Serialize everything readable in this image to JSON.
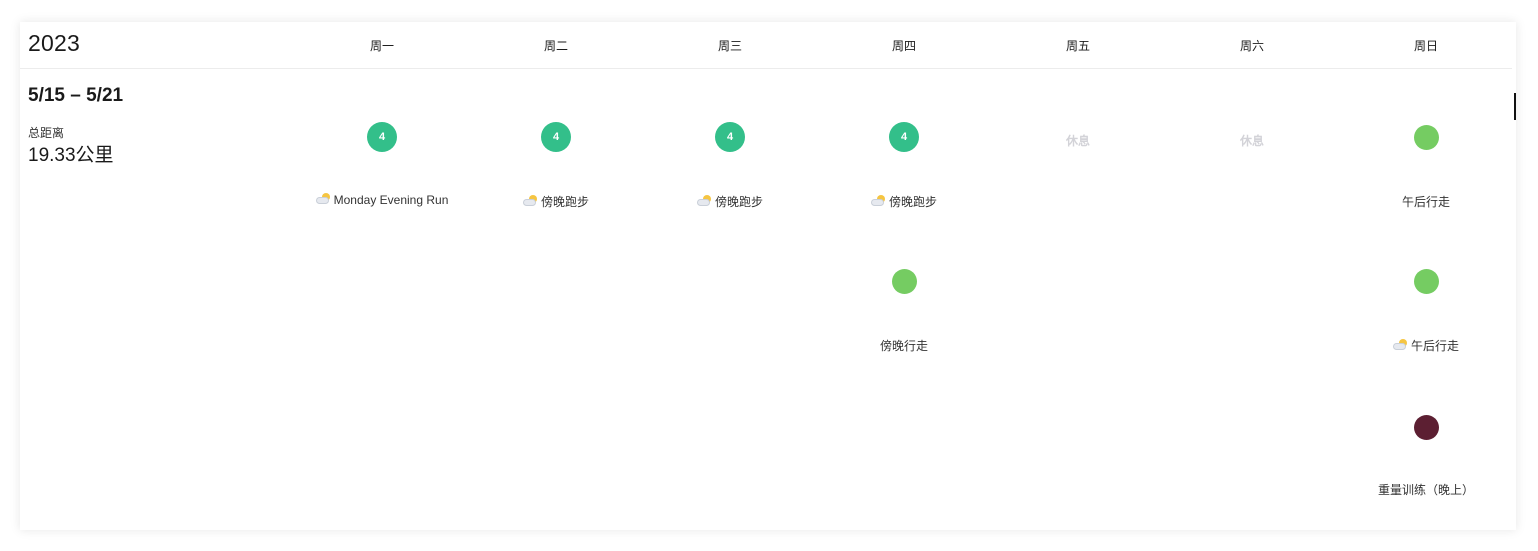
{
  "header": {
    "year": "2023",
    "days": [
      "周一",
      "周二",
      "周三",
      "周四",
      "周五",
      "周六",
      "周日"
    ]
  },
  "summary": {
    "range": "5/15 – 5/21",
    "distance_label": "总距离",
    "distance_value": "19.33公里"
  },
  "colors": {
    "run": "#33bf8a",
    "walk": "#75cc62",
    "weights": "#5c1f32",
    "rest": "#d3d3d8"
  },
  "days": [
    {
      "day": "周一",
      "rest": false,
      "activities": [
        {
          "type": "run",
          "badge": "4",
          "name": "Monday Evening Run",
          "weather_icon": "partly-cloudy-icon"
        }
      ]
    },
    {
      "day": "周二",
      "rest": false,
      "activities": [
        {
          "type": "run",
          "badge": "4",
          "name": "傍晚跑步",
          "weather_icon": "partly-cloudy-icon"
        }
      ]
    },
    {
      "day": "周三",
      "rest": false,
      "activities": [
        {
          "type": "run",
          "badge": "4",
          "name": "傍晚跑步",
          "weather_icon": "partly-cloudy-icon"
        }
      ]
    },
    {
      "day": "周四",
      "rest": false,
      "activities": [
        {
          "type": "run",
          "badge": "4",
          "name": "傍晚跑步",
          "weather_icon": "partly-cloudy-icon"
        },
        {
          "type": "walk",
          "badge": "",
          "name": "傍晚行走",
          "weather_icon": ""
        }
      ]
    },
    {
      "day": "周五",
      "rest": true,
      "rest_label": "休息",
      "activities": []
    },
    {
      "day": "周六",
      "rest": true,
      "rest_label": "休息",
      "activities": []
    },
    {
      "day": "周日",
      "rest": false,
      "activities": [
        {
          "type": "walk",
          "badge": "",
          "name": "午后行走",
          "weather_icon": ""
        },
        {
          "type": "walk",
          "badge": "",
          "name": "午后行走",
          "weather_icon": "partly-cloudy-icon"
        },
        {
          "type": "weights",
          "badge": "",
          "name": "重量训练（晚上）",
          "weather_icon": ""
        }
      ]
    }
  ]
}
